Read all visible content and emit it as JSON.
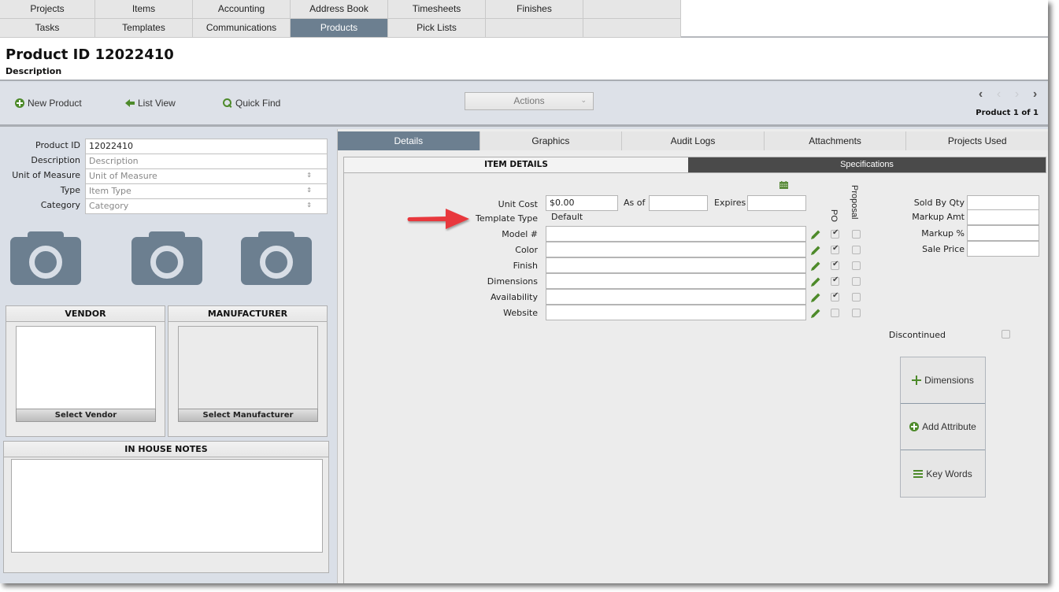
{
  "nav": {
    "row1": [
      "Projects",
      "Items",
      "Accounting",
      "Address Book",
      "Timesheets",
      "Finishes",
      ""
    ],
    "row2": [
      "Tasks",
      "Templates",
      "Communications",
      "Products",
      "Pick Lists",
      "",
      ""
    ],
    "active": "Products"
  },
  "header": {
    "title": "Product ID 12022410",
    "subtitle": "Description"
  },
  "toolbar": {
    "new_product": "New Product",
    "list_view": "List View",
    "quick_find": "Quick Find",
    "actions": "Actions",
    "pager_label": "Product 1 of 1"
  },
  "product_form": {
    "product_id_label": "Product ID",
    "product_id_value": "12022410",
    "description_label": "Description",
    "description_placeholder": "Description",
    "uom_label": "Unit of Measure",
    "uom_placeholder": "Unit of Measure",
    "type_label": "Type",
    "type_placeholder": "Item Type",
    "category_label": "Category",
    "category_placeholder": "Category"
  },
  "vendor": {
    "title": "VENDOR",
    "button": "Select Vendor"
  },
  "manufacturer": {
    "title": "MANUFACTURER",
    "button": "Select Manufacturer"
  },
  "notes": {
    "title": "IN HOUSE NOTES",
    "value": ""
  },
  "tabs": [
    "Details",
    "Graphics",
    "Audit Logs",
    "Attachments",
    "Projects Used"
  ],
  "active_tab": "Details",
  "subtabs": {
    "item_details": "ITEM DETAILS",
    "specifications": "Specifications"
  },
  "details": {
    "unit_cost_label": "Unit Cost",
    "unit_cost_value": "$0.00",
    "as_of_label": "As of",
    "as_of_value": "",
    "expires_label": "Expires",
    "expires_value": "",
    "template_type_label": "Template Type",
    "template_type_value": "Default",
    "po_label": "PO",
    "proposal_label": "Proposal",
    "attributes": [
      {
        "label": "Model #",
        "value": "",
        "po": true,
        "proposal": false
      },
      {
        "label": "Color",
        "value": "",
        "po": true,
        "proposal": false
      },
      {
        "label": "Finish",
        "value": "",
        "po": true,
        "proposal": false
      },
      {
        "label": "Dimensions",
        "value": "",
        "po": true,
        "proposal": false
      },
      {
        "label": "Availability",
        "value": "",
        "po": true,
        "proposal": false
      },
      {
        "label": "Website",
        "value": "",
        "po": false,
        "proposal": false
      }
    ]
  },
  "pricing": {
    "sold_by_qty_label": "Sold By Qty",
    "markup_amt_label": "Markup Amt",
    "markup_pct_label": "Markup %",
    "sale_price_label": "Sale Price",
    "sold_by_qty": "",
    "markup_amt": "",
    "markup_pct": "",
    "sale_price": "",
    "discontinued_label": "Discontinued",
    "discontinued": false
  },
  "side_buttons": {
    "dimensions": "Dimensions",
    "add_attribute": "Add Attribute",
    "key_words": "Key Words"
  },
  "colors": {
    "accent_green": "#4d8a2a",
    "active_tab": "#6c7f90",
    "annotation_arrow": "#e8383d"
  }
}
